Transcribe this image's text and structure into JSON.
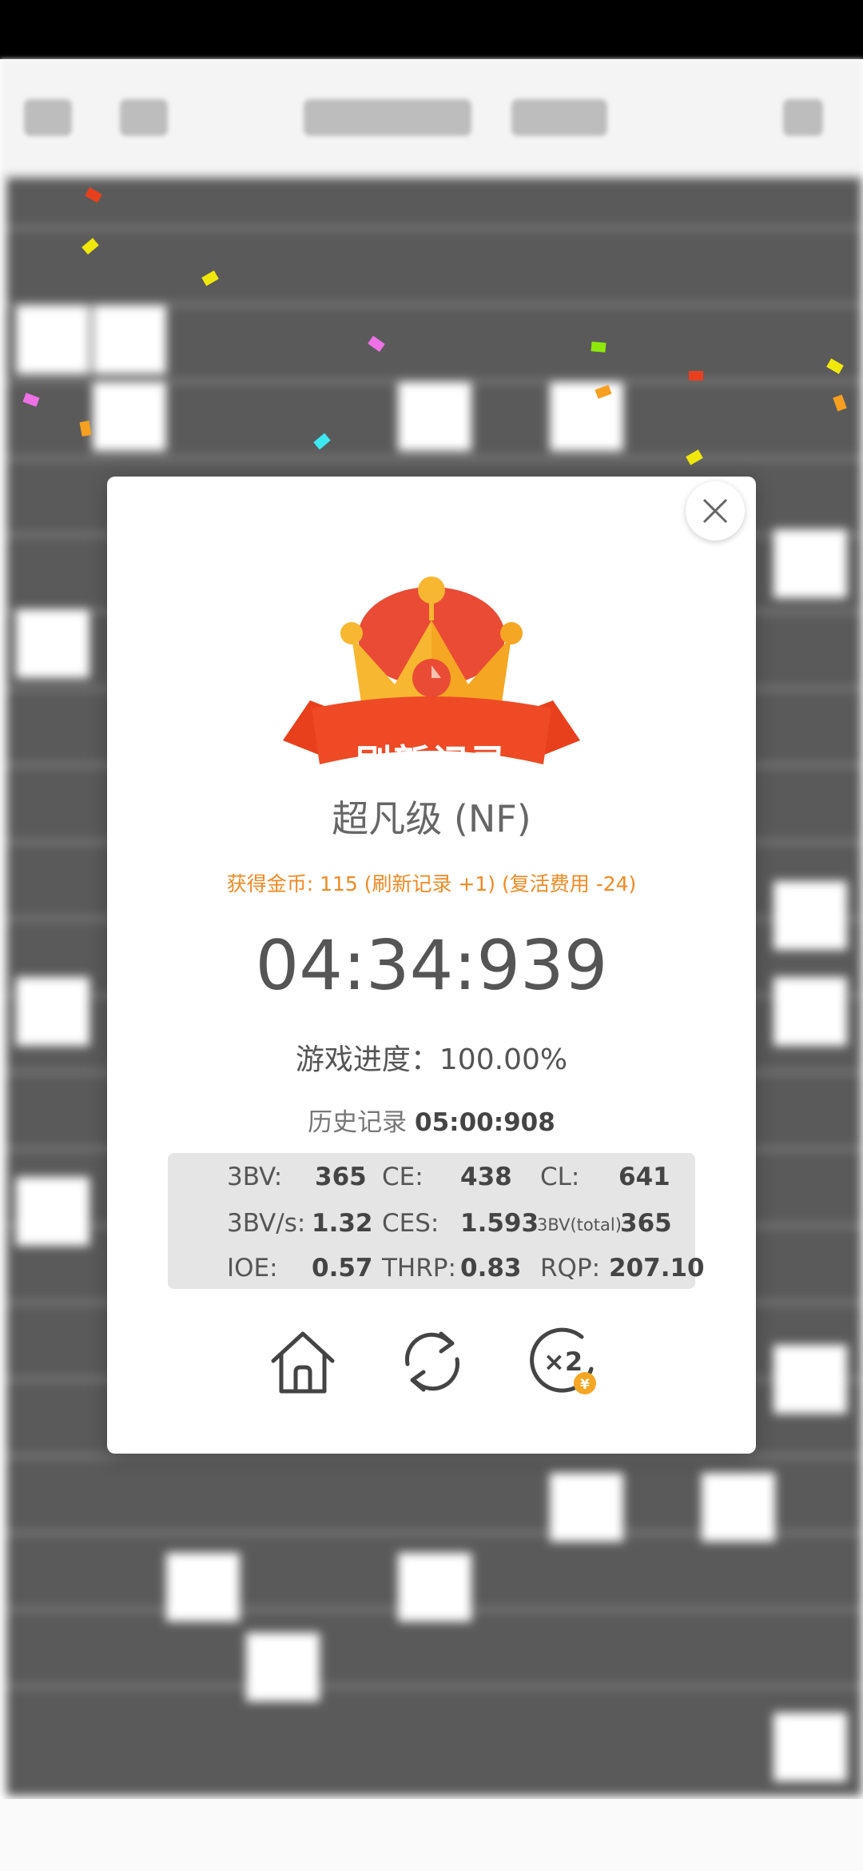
{
  "dialog": {
    "banner_text": "刷新记录",
    "level_title": "超凡级 (NF)",
    "coins_line": "获得金币: 115 (刷新记录 +1) (复活费用 -24)",
    "time": "04:34:939",
    "progress_line": "游戏进度：100.00%",
    "history_label": "历史记录",
    "history_time": "05:00:908",
    "stats": [
      {
        "label": "3BV:",
        "value": "365"
      },
      {
        "label": "CE:",
        "value": "438"
      },
      {
        "label": "CL:",
        "value": "641"
      },
      {
        "label": "3BV/s:",
        "value": "1.32"
      },
      {
        "label": "CES:",
        "value": "1.593"
      },
      {
        "label": "3BV(total):",
        "value": "365"
      },
      {
        "label": "IOE:",
        "value": "0.57"
      },
      {
        "label": "THRP:",
        "value": "0.83"
      },
      {
        "label": "RQP:",
        "value": "207.10"
      }
    ],
    "actions": [
      {
        "icon": "home-icon"
      },
      {
        "icon": "refresh-icon"
      },
      {
        "icon": "double-coins-icon",
        "label": "×2",
        "coin_mark": "¥"
      }
    ],
    "close_icon": "close-icon"
  },
  "colors": {
    "accent_orange": "#f08a24",
    "ribbon_red": "#e8401c",
    "crown_yellow": "#f7b731",
    "crown_red": "#e94b35"
  }
}
